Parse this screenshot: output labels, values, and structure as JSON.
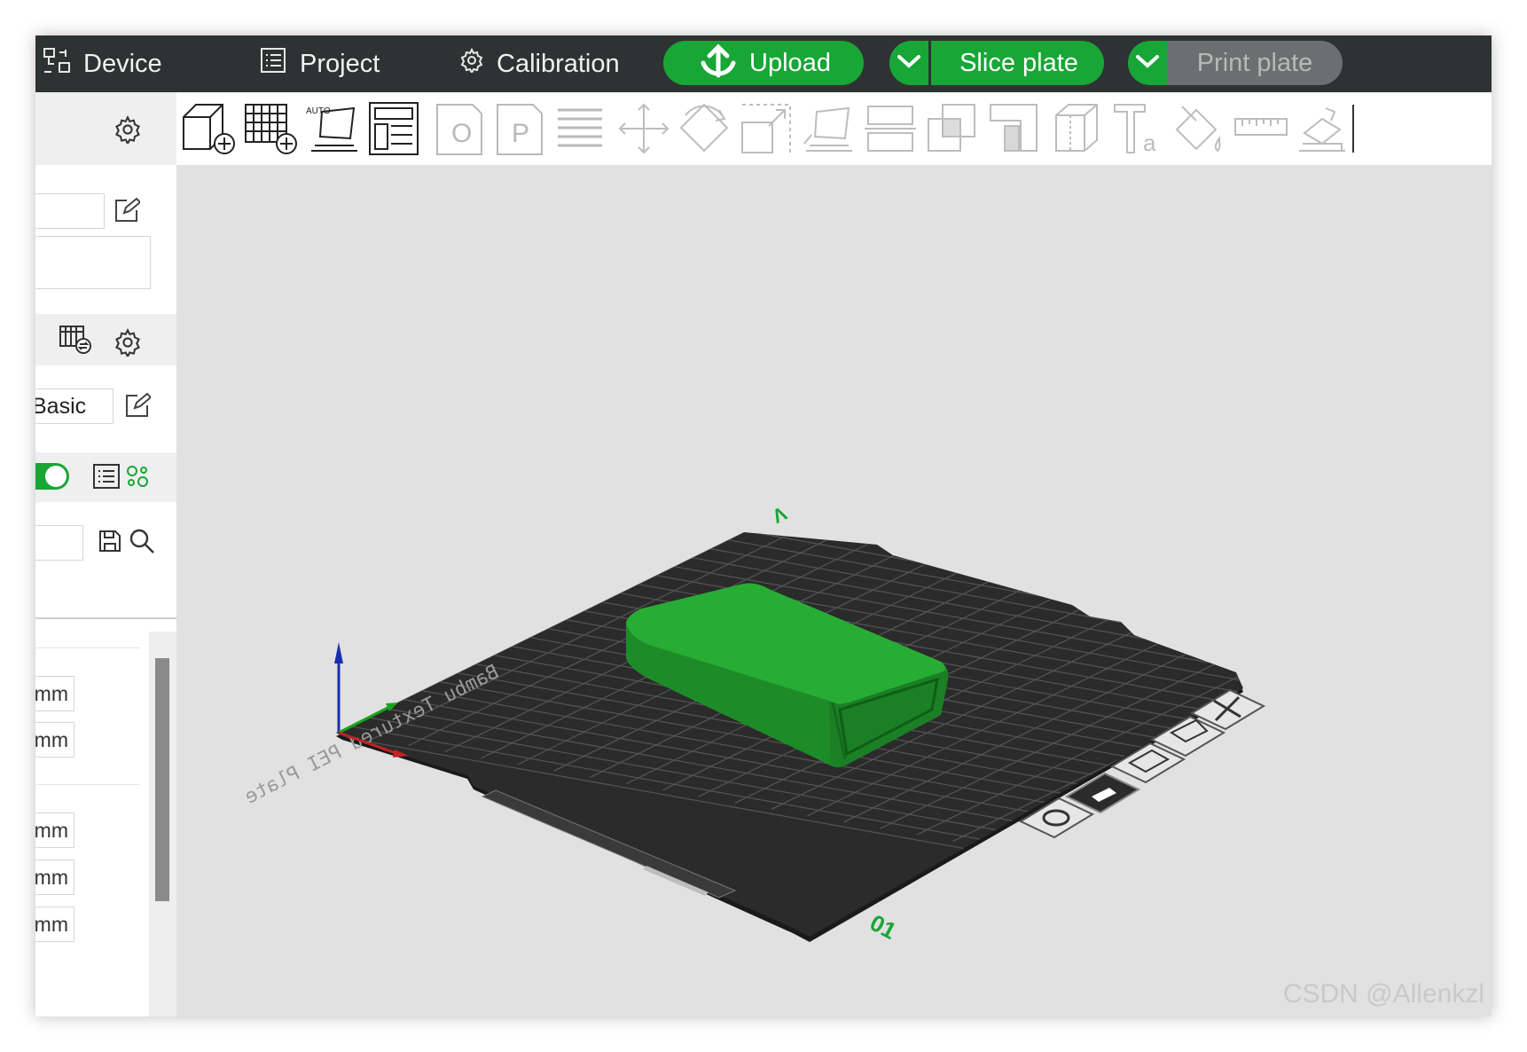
{
  "topbar": {
    "device_label": "Device",
    "project_label": "Project",
    "calibration_label": "Calibration",
    "upload_label": "Upload",
    "slice_label": "Slice plate",
    "print_label": "Print plate"
  },
  "sidebar": {
    "process_preset_value": "Basic",
    "units": [
      "mm",
      "mm",
      "mm",
      "mm",
      "mm"
    ],
    "toggle_on": true
  },
  "toolbar": {
    "icons": [
      "add-object-icon",
      "add-plate-icon",
      "auto-orient-icon",
      "arrange-icon",
      "split-objects-icon",
      "split-parts-icon",
      "variable-layer-icon",
      "move-icon",
      "rotate-icon",
      "scale-icon",
      "lay-on-face-icon",
      "cut-icon",
      "boolean-icon",
      "support-paint-icon",
      "seam-paint-icon",
      "text-icon",
      "color-paint-icon",
      "measure-icon",
      "assembly-icon"
    ]
  },
  "viewport": {
    "plate_label": "Bambu Textured PEI Plate",
    "plate_number": "01",
    "model_color": "#1f9e2c",
    "bed_color": "#2b2b2b"
  },
  "watermark": "CSDN @Allenkzl",
  "colors": {
    "accent": "#18a636",
    "topbar": "#2f3233",
    "viewport_bg": "#e1e1e1"
  }
}
